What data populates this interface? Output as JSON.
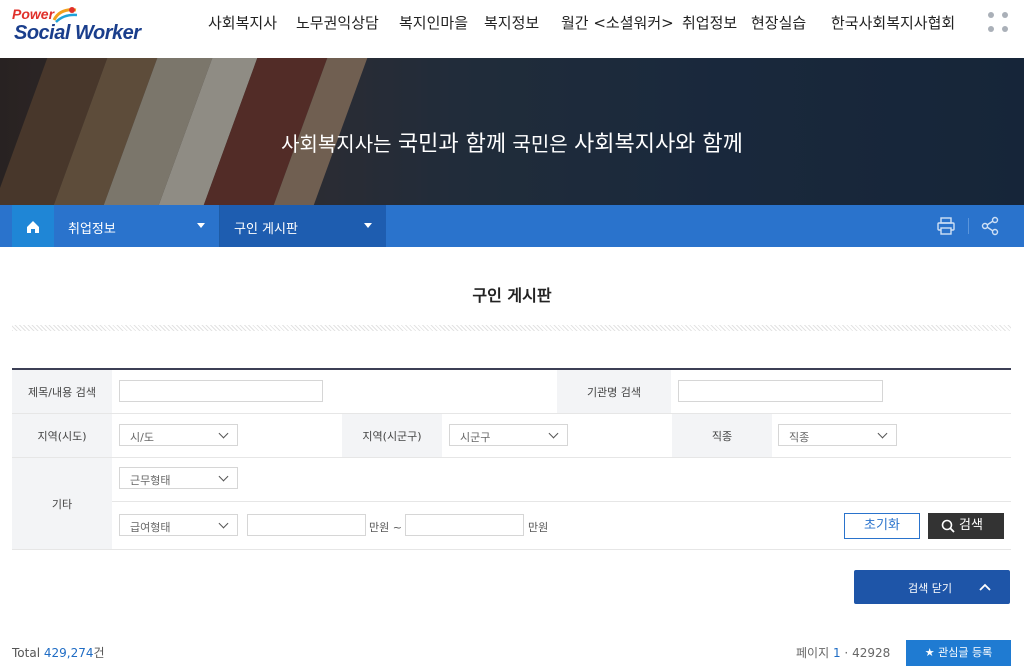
{
  "logo": {
    "power": "Power",
    "name": "Social Worker"
  },
  "nav": {
    "items": [
      "사회복지사",
      "노무권익상담",
      "복지인마을",
      "복지정보",
      "월간 <소셜워커>",
      "취업정보",
      "현장실습",
      "한국사회복지사협회"
    ]
  },
  "banner": {
    "slogan_parts": [
      "사회복지사는 ",
      "국민과 함께",
      " 국민은 ",
      "사회복지사와 함께"
    ]
  },
  "location": {
    "depth1": "취업정보",
    "depth2": "구인 게시판"
  },
  "page": {
    "title": "구인 게시판"
  },
  "search": {
    "title_label": "제목/내용 검색",
    "org_label": "기관명 검색",
    "region_sido_label": "지역(시도)",
    "region_sido_value": "시/도",
    "region_sigungu_label": "지역(시군구)",
    "region_sigungu_value": "시군구",
    "job_label": "직종",
    "job_value": "직종",
    "etc_label": "기타",
    "work_type_value": "근무형태",
    "pay_type_value": "급여형태",
    "pay_unit_from": "만원 ~",
    "pay_unit_to": "만원",
    "reset_label": "초기화",
    "search_label": "검색",
    "close_label": "검색 닫기"
  },
  "list": {
    "total_label": "Total",
    "total_count": "429,274",
    "total_suffix": "건",
    "page_label": "페이지",
    "current_page": "1",
    "total_pages": "42928",
    "favorite_label": "관심글 등록"
  },
  "colors": {
    "primary": "#2a73cc",
    "dark_blue": "#1e55a8",
    "brand_red": "#e0302a",
    "brand_navy": "#1a3e8c"
  }
}
